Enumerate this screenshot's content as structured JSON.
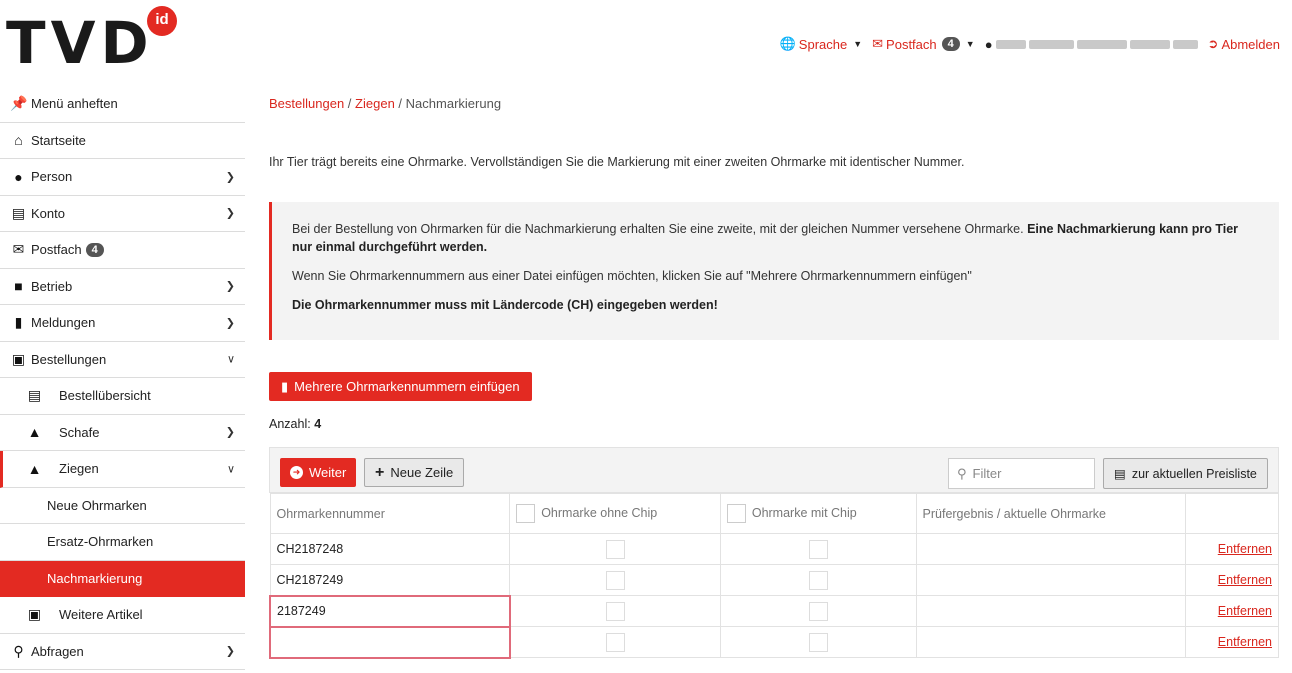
{
  "header": {
    "logo_text": "TVD",
    "logo_badge": "id",
    "nav": {
      "sprache": "Sprache",
      "postfach": "Postfach",
      "postfach_count": "4",
      "abmelden": "Abmelden"
    }
  },
  "sidebar": {
    "items": [
      {
        "label": "Menü anheften",
        "icon": "pin-icon"
      },
      {
        "label": "Startseite",
        "icon": "home-icon"
      },
      {
        "label": "Person",
        "icon": "person-icon"
      },
      {
        "label": "Konto",
        "icon": "account-icon"
      },
      {
        "label": "Postfach",
        "icon": "envelope-icon",
        "badge": "4"
      },
      {
        "label": "Betrieb",
        "icon": "industry-icon"
      },
      {
        "label": "Meldungen",
        "icon": "clipboard-icon"
      },
      {
        "label": "Bestellungen",
        "icon": "bag-icon"
      },
      {
        "label": "Bestellübersicht",
        "icon": "list-icon"
      },
      {
        "label": "Schafe",
        "icon": "sheep-icon"
      },
      {
        "label": "Ziegen",
        "icon": "goat-icon"
      },
      {
        "label": "Neue Ohrmarken"
      },
      {
        "label": "Ersatz-Ohrmarken"
      },
      {
        "label": "Nachmarkierung"
      },
      {
        "label": "Weitere Artikel",
        "icon": "box-icon"
      },
      {
        "label": "Abfragen",
        "icon": "search-icon"
      }
    ]
  },
  "breadcrumb": {
    "b1": "Bestellungen",
    "b2": "Ziegen",
    "b3": "Nachmarkierung",
    "sep": "/"
  },
  "intro": "Ihr Tier trägt bereits eine Ohrmarke. Vervollständigen Sie die Markierung mit einer zweiten Ohrmarke mit identischer Nummer.",
  "info": {
    "p1_normal": "Bei der Bestellung von Ohrmarken für die Nachmarkierung erhalten Sie eine zweite, mit der gleichen Nummer versehene Ohrmarke. ",
    "p1_bold": "Eine Nachmarkierung kann pro Tier nur einmal durchgeführt werden.",
    "p2": "Wenn Sie Ohrmarkennummern aus einer Datei einfügen möchten, klicken Sie auf \"Mehrere Ohrmarkennummern einfügen\"",
    "p3": "Die Ohrmarkennummer muss mit Ländercode (CH) eingegeben werden!"
  },
  "multi_button": "Mehrere Ohrmarkennummern einfügen",
  "anzahl_label": "Anzahl:",
  "anzahl_value": "4",
  "toolbar": {
    "weiter": "Weiter",
    "neue_zeile": "Neue Zeile",
    "filter_placeholder": "Filter",
    "preisliste": "zur aktuellen Preisliste"
  },
  "table": {
    "headers": [
      "Ohrmarkennummer",
      "Ohrmarke ohne Chip",
      "Ohrmarke mit Chip",
      "Prüfergebnis / aktuelle Ohrmarke",
      ""
    ],
    "rows": [
      {
        "nummer": "CH2187248",
        "action": "Entfernen",
        "error": false
      },
      {
        "nummer": "CH2187249",
        "action": "Entfernen",
        "error": false
      },
      {
        "nummer": "2187249",
        "action": "Entfernen",
        "error": true
      },
      {
        "nummer": "",
        "action": "Entfernen",
        "error": true
      }
    ]
  }
}
